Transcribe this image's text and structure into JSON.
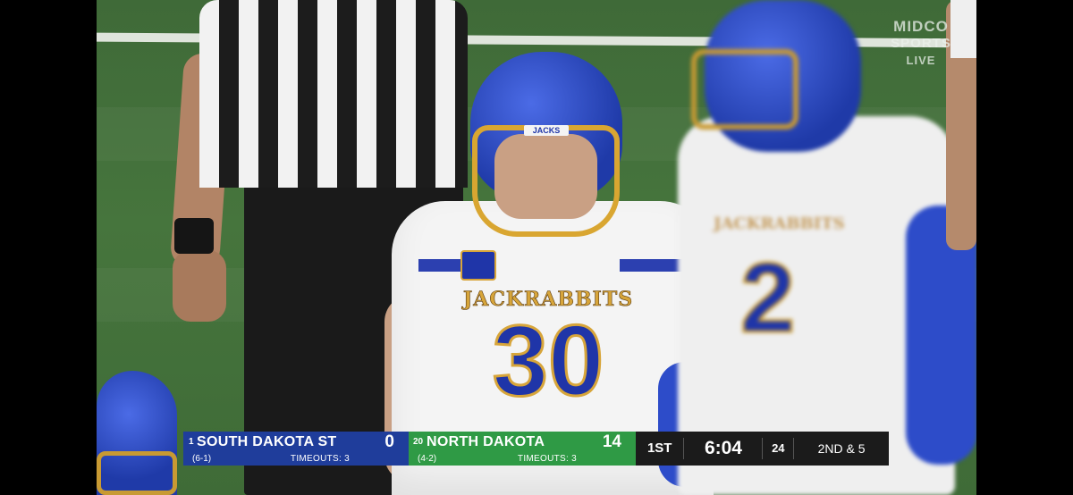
{
  "watermark": {
    "line1": "MIDCO",
    "line2": "SPORTS",
    "line3": "LIVE"
  },
  "scorebug": {
    "away": {
      "rank": "1",
      "name": "SOUTH DAKOTA ST",
      "record": "(6-1)",
      "timeouts": "TIMEOUTS: 3",
      "score": "0",
      "color": "#1f3d9b"
    },
    "home": {
      "rank": "20",
      "name": "NORTH DAKOTA",
      "record": "(4-2)",
      "timeouts": "TIMEOUTS: 3",
      "score": "14",
      "color": "#2f9a45"
    },
    "quarter": "1ST",
    "clock": "6:04",
    "play_clock": "24",
    "down_distance": "2ND & 5"
  },
  "jersey": {
    "chest": "JACKRABBITS",
    "number": "30",
    "helmet": "JACKS"
  },
  "jersey2": {
    "chest": "JACKRABBITS",
    "number": "2"
  },
  "colors": {
    "primary_blue": "#1f35a8",
    "gold": "#d7a53a",
    "field": "#46753d"
  }
}
